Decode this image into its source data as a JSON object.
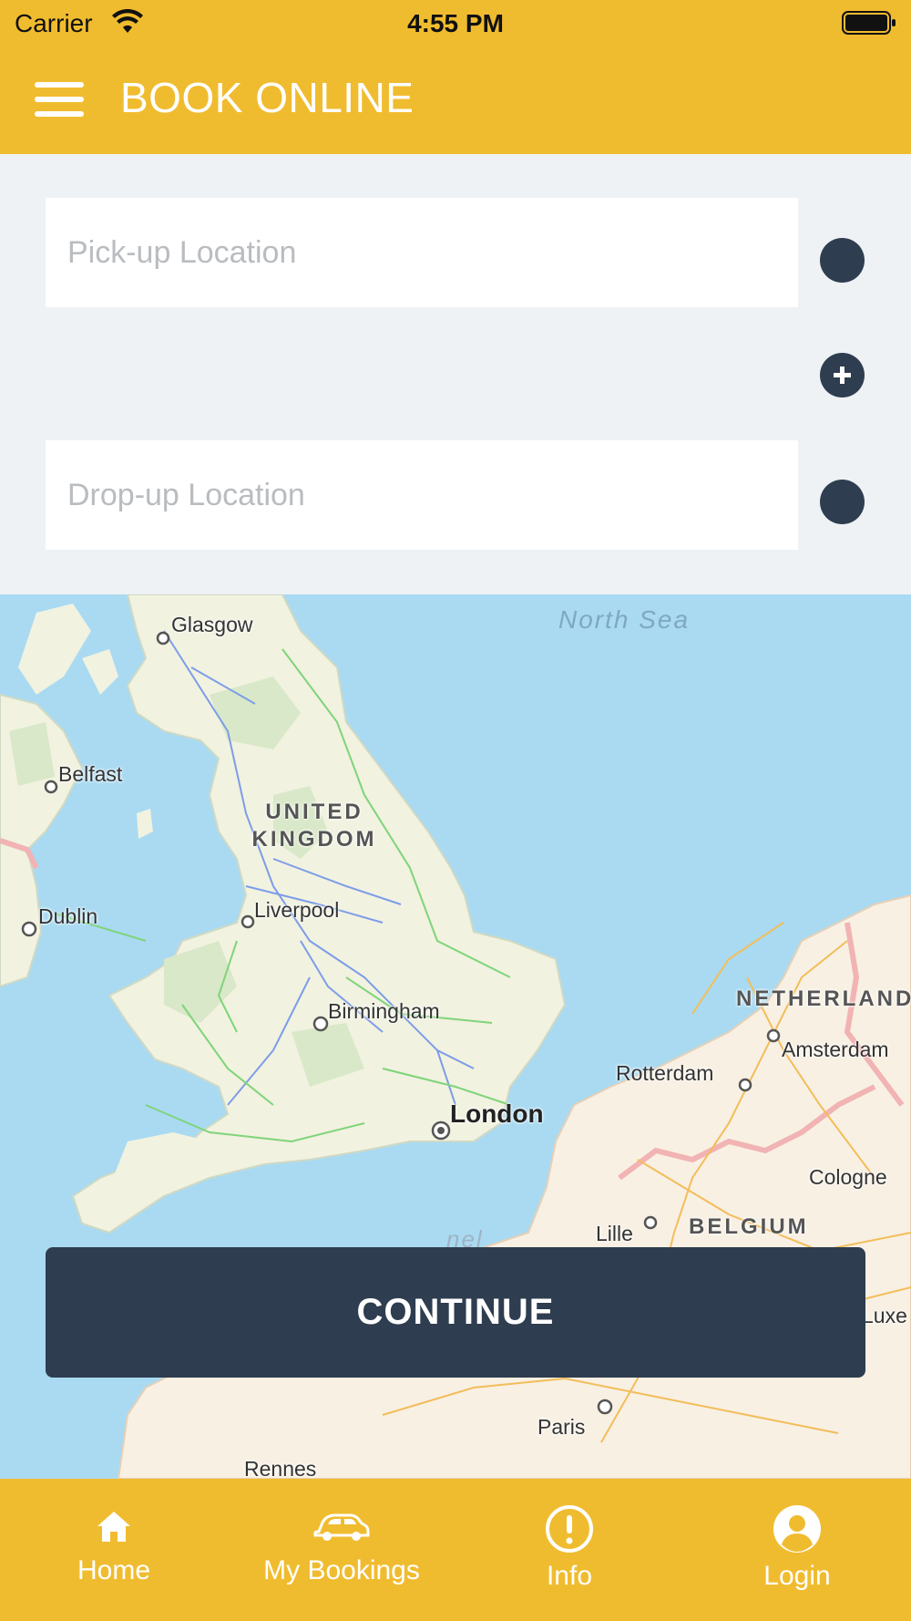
{
  "status": {
    "carrier": "Carrier",
    "time": "4:55 PM"
  },
  "header": {
    "title": "BOOK ONLINE",
    "menu_icon": "hamburger-menu-icon"
  },
  "form": {
    "pickup_placeholder": "Pick-up Location",
    "pickup_value": "",
    "dropoff_placeholder": "Drop-up Location",
    "dropoff_value": ""
  },
  "map": {
    "sea": "North Sea",
    "country_uk": "UNITED KINGDOM",
    "cities": {
      "glasgow": "Glasgow",
      "belfast": "Belfast",
      "dublin": "Dublin",
      "liverpool": "Liverpool",
      "birmingham": "Birmingham",
      "london": "London",
      "rotterdam": "Rotterdam",
      "amsterdam": "Amsterdam",
      "cologne": "Cologne",
      "lille": "Lille",
      "paris": "Paris",
      "rennes": "Rennes",
      "luxembourg_partial": "Luxe"
    },
    "country_nl_partial": "NETHERLAND",
    "country_be": "BELGIUM",
    "channel_partial": "nel"
  },
  "actions": {
    "continue_label": "CONTINUE"
  },
  "tabbar": {
    "items": [
      {
        "label": "Home",
        "icon": "home-icon"
      },
      {
        "label": "My Bookings",
        "icon": "car-icon"
      },
      {
        "label": "Info",
        "icon": "info-icon"
      },
      {
        "label": "Login",
        "icon": "user-icon"
      }
    ]
  },
  "colors": {
    "accent": "#f0bc2f",
    "dark": "#2e3d4f",
    "background": "#eef2f5",
    "water": "#a9daf2",
    "land": "#f1f2e0"
  }
}
